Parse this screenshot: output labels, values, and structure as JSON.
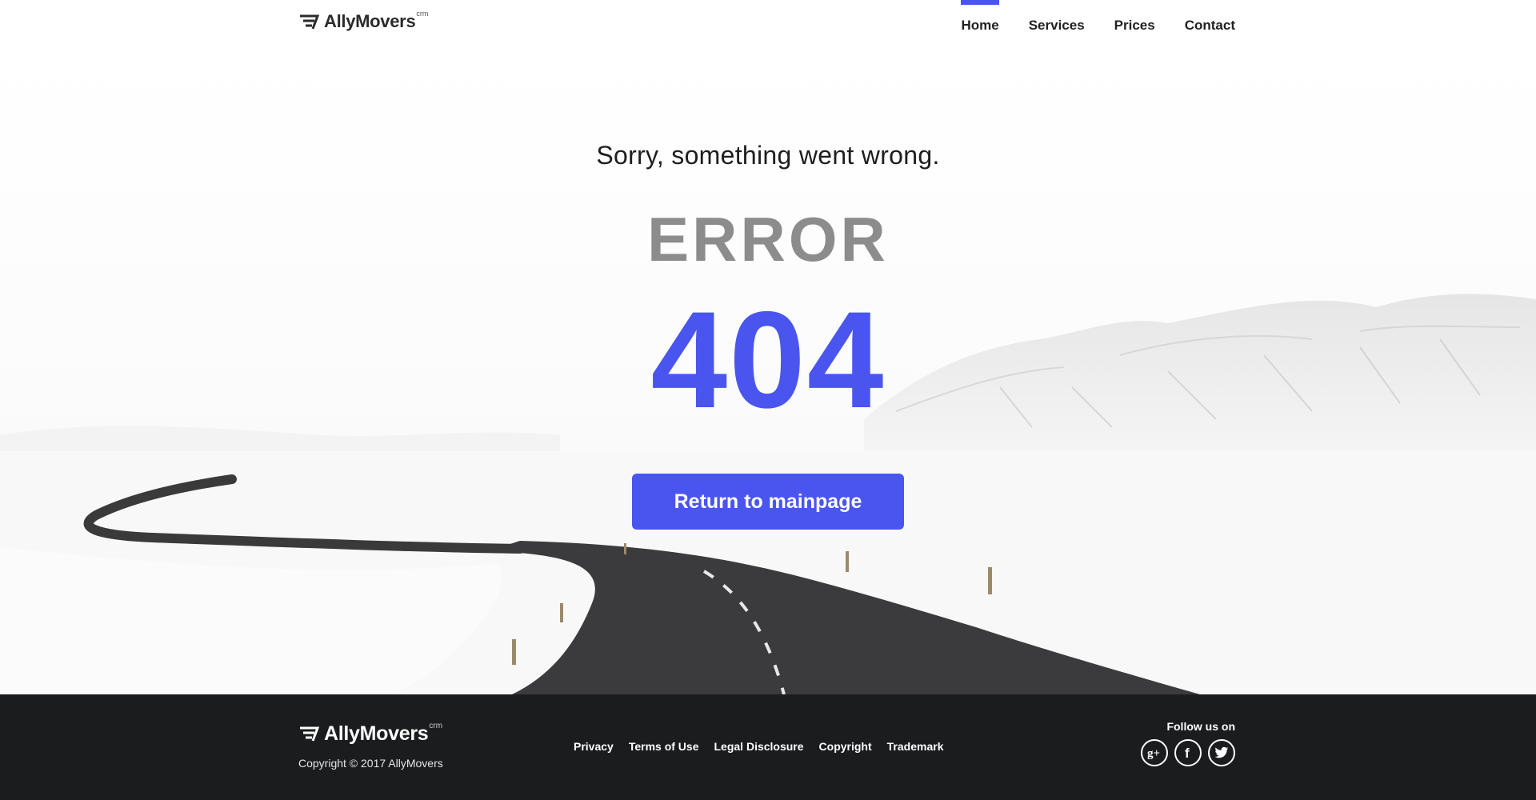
{
  "brand": {
    "name": "AllyMovers",
    "sup": "crm"
  },
  "nav": {
    "active": "Home",
    "items": [
      {
        "label": "Home"
      },
      {
        "label": "Services"
      },
      {
        "label": "Prices"
      },
      {
        "label": "Contact"
      }
    ]
  },
  "hero": {
    "message": "Sorry, something went wrong.",
    "error_word": "ERROR",
    "code": "404",
    "button_label": "Return to mainpage"
  },
  "footer": {
    "copyright": "Copyright © 2017 AllyMovers",
    "links": [
      {
        "label": "Privacy"
      },
      {
        "label": "Terms of Use"
      },
      {
        "label": "Legal Disclosure"
      },
      {
        "label": "Copyright"
      },
      {
        "label": "Trademark"
      }
    ],
    "follow_label": "Follow us on",
    "socials": [
      {
        "icon": "google-plus-icon",
        "glyph": "g+"
      },
      {
        "icon": "facebook-icon",
        "glyph": "f"
      },
      {
        "icon": "twitter-icon",
        "glyph": "t"
      }
    ]
  },
  "colors": {
    "accent": "#4a55f0",
    "footer_bg": "#1b1c1e",
    "error_gray": "#8c8c8c"
  }
}
